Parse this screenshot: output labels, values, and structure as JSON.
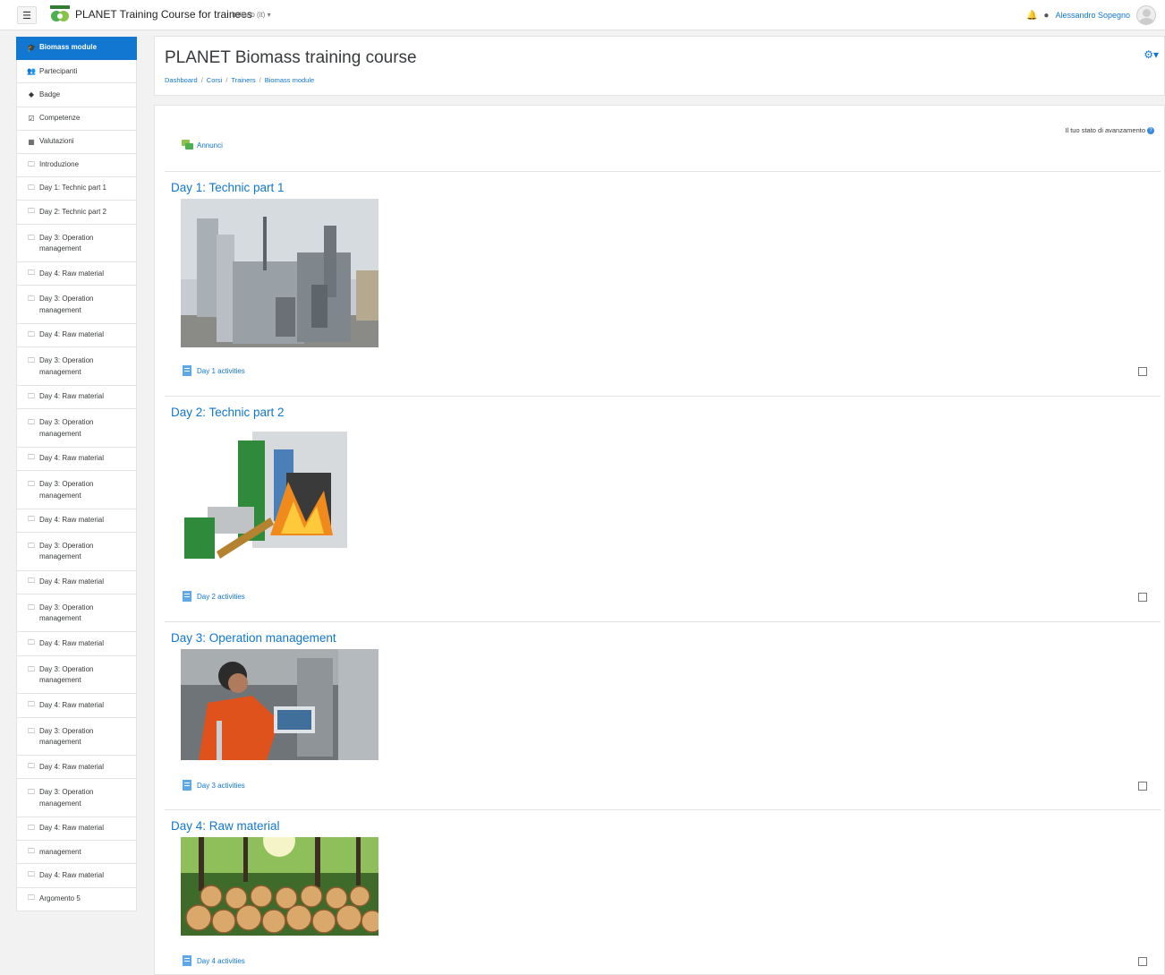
{
  "navbar": {
    "menu_icon": "hamburger-icon",
    "site_title": "PLANET Training Course for trainees",
    "language": "Italiano (it) ▾",
    "user_name": "Alessandro Sopegno",
    "icons": [
      "bell-icon",
      "chat-icon",
      "avatar"
    ]
  },
  "sidebar": {
    "items": [
      {
        "label": "Biomass module",
        "icon": "graduation-cap-icon",
        "active": true
      },
      {
        "label": "Partecipanti",
        "icon": "users-icon"
      },
      {
        "label": "Badge",
        "icon": "shield-icon"
      },
      {
        "label": "Competenze",
        "icon": "checkbox-icon"
      },
      {
        "label": "Valutazioni",
        "icon": "table-icon"
      },
      {
        "label": "Introduzione",
        "icon": "folder-icon"
      },
      {
        "label": "Day 1: Technic part 1",
        "icon": "folder-icon"
      },
      {
        "label": "Day 2: Technic part 2",
        "icon": "folder-icon"
      },
      {
        "label": "Day 3: Operation management",
        "icon": "folder-icon"
      },
      {
        "label": "Day 4: Raw material",
        "icon": "folder-icon"
      },
      {
        "label": "Day 3: Operation management",
        "icon": "folder-icon"
      },
      {
        "label": "Day 4: Raw material",
        "icon": "folder-icon"
      },
      {
        "label": "Day 3: Operation management",
        "icon": "folder-icon"
      },
      {
        "label": "Day 4: Raw material",
        "icon": "folder-icon"
      },
      {
        "label": "Day 3: Operation management",
        "icon": "folder-icon"
      },
      {
        "label": "Day 4: Raw material",
        "icon": "folder-icon"
      },
      {
        "label": "Day 3: Operation management",
        "icon": "folder-icon"
      },
      {
        "label": "Day 4: Raw material",
        "icon": "folder-icon"
      },
      {
        "label": "Day 3: Operation management",
        "icon": "folder-icon"
      },
      {
        "label": "Day 4: Raw material",
        "icon": "folder-icon"
      },
      {
        "label": "Day 3: Operation management",
        "icon": "folder-icon"
      },
      {
        "label": "Day 4: Raw material",
        "icon": "folder-icon"
      },
      {
        "label": "Day 3: Operation management",
        "icon": "folder-icon"
      },
      {
        "label": "Day 4: Raw material",
        "icon": "folder-icon"
      },
      {
        "label": "Day 3: Operation management",
        "icon": "folder-icon"
      },
      {
        "label": "Day 4: Raw material",
        "icon": "folder-icon"
      },
      {
        "label": "Day 3: Operation management",
        "icon": "folder-icon"
      },
      {
        "label": "Day 4: Raw material",
        "icon": "folder-icon"
      },
      {
        "label": "management",
        "icon": "folder-icon"
      },
      {
        "label": "Day 4: Raw material",
        "icon": "folder-icon"
      },
      {
        "label": "Argomento 5",
        "icon": "folder-icon"
      }
    ]
  },
  "header": {
    "title": "PLANET Biomass training course",
    "breadcrumb": [
      "Dashboard",
      "Corsi",
      "Trainers",
      "Biomass module"
    ],
    "settings_icon": "gear-icon"
  },
  "main": {
    "progress_label": "Il tuo stato di avanzamento",
    "announcements_label": "Annunci",
    "sections": [
      {
        "title": "Day 1: Technic part 1",
        "image": "biomass-plant-building-photo",
        "activity_label": "Day 1 activities",
        "completed": false
      },
      {
        "title": "Day 2: Technic part 2",
        "image": "boiler-cutaway-illustration",
        "activity_label": "Day 2 activities",
        "completed": false
      },
      {
        "title": "Day 3: Operation management",
        "image": "operator-with-laptop-photo",
        "activity_label": "Day 3 activities",
        "completed": false
      },
      {
        "title": "Day 4: Raw material",
        "image": "log-pile-forest-photo",
        "activity_label": "Day 4 activities",
        "completed": false
      }
    ]
  },
  "colors": {
    "accent": "#1177d1",
    "background": "#f2f2f2",
    "card": "#ffffff"
  }
}
